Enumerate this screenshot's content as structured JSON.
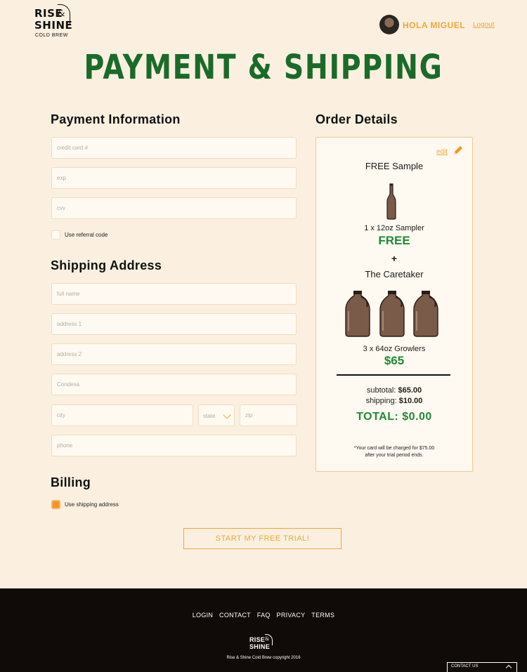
{
  "brand": {
    "logo_line1": "RISE",
    "logo_amp": "&",
    "logo_line2": "SHINE",
    "logo_sub": "COLD BREW"
  },
  "header": {
    "greeting": "HOLA MIGUEL",
    "logout": "Logout"
  },
  "page_title": "PAYMENT & SHIPPING",
  "payment": {
    "heading": "Payment Information",
    "card_placeholder": "credit card #",
    "exp_placeholder": "exp",
    "cvv_placeholder": "cvv",
    "referral_label": "Use referral code",
    "referral_checked": false
  },
  "shipping": {
    "heading": "Shipping Address",
    "full_name_placeholder": "full name",
    "address1_placeholder": "address 1",
    "address2_placeholder": "address 2",
    "neighborhood_placeholder": "Condesa",
    "city_placeholder": "city",
    "state_label": "state",
    "zip_placeholder": "zip",
    "phone_placeholder": "phone"
  },
  "billing": {
    "heading": "Billing",
    "same_label": "Use shipping address",
    "same_checked": true
  },
  "order": {
    "heading": "Order Details",
    "edit": "edit",
    "sample_title": "FREE Sample",
    "sample_qty": "1 x 12oz Sampler",
    "sample_price": "FREE",
    "plus": "+",
    "plan_title": "The Caretaker",
    "plan_qty": "3 x 64oz Growlers",
    "plan_price": "$65",
    "subtotal_label": "subtotal:",
    "subtotal_value": "$65.00",
    "shipping_label": "shipping:",
    "shipping_value": "$10.00",
    "total_label": "TOTAL:",
    "total_value": "$0.00",
    "note_line1": "*Your card will be charged for $75.00",
    "note_line2": "after your trial period ends."
  },
  "cta": "START MY FREE TRIAL!",
  "footer": {
    "links": [
      "LOGIN",
      "CONTACT",
      "FAQ",
      "PRIVACY",
      "TERMS"
    ],
    "logo_line1": "RISE",
    "logo_amp": "&",
    "logo_line2": "SHINE",
    "copyright": "Rise & Shine Cold Brew copyright 2016",
    "contact_tab": "CONTACT US"
  },
  "icons": {
    "pencil": "pencil-icon",
    "bottle": "bottle-icon",
    "growler": "growler-icon",
    "chevron": "chevron-down-icon"
  },
  "colors": {
    "background": "#fbf0df",
    "accent": "#f0a63a",
    "title_green": "#1a6b2a",
    "price_green": "#1e8a34",
    "footer": "#100b08"
  }
}
